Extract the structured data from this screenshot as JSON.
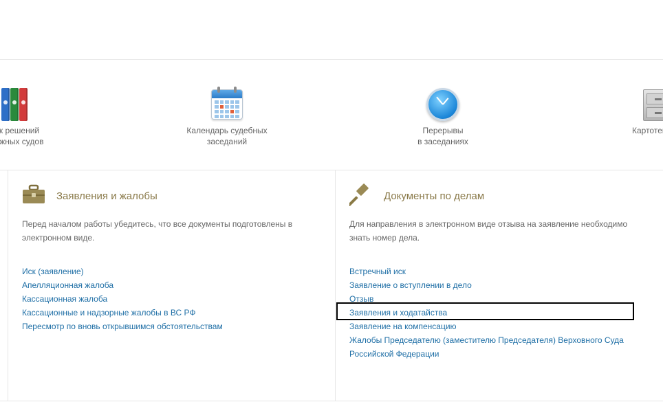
{
  "nav": {
    "items": [
      {
        "label": "к решений\nажных судов",
        "icon": "folders-icon"
      },
      {
        "label": "Календарь судебных\nзаседаний",
        "icon": "calendar-icon"
      },
      {
        "label": "Перерывы\nв заседаниях",
        "icon": "clock-icon"
      },
      {
        "label": "Картотек",
        "icon": "file-cabinet-icon"
      }
    ]
  },
  "left_panel": {
    "title": "Заявления и жалобы",
    "icon": "briefcase-icon",
    "description": "Перед началом работы убедитесь, что все документы подготовлены в электронном виде.",
    "links": [
      "Иск (заявление)",
      "Апелляционная жалоба",
      "Кассационная жалоба",
      "Кассационные и надзорные жалобы в ВС РФ",
      "Пересмотр по вновь открывшимся обстоятельствам"
    ]
  },
  "right_panel": {
    "title": "Документы по делам",
    "icon": "gavel-icon",
    "description": "Для направления в электронном виде отзыва на заявление необходимо знать номер дела.",
    "links": [
      "Встречный иск",
      "Заявление о вступлении в дело",
      "Отзыв",
      "Заявления и ходатайства",
      "Заявление на компенсацию",
      "Жалобы Председателю (заместителю Председателя) Верховного Суда",
      "Российской Федерации"
    ]
  },
  "colors": {
    "link": "#1f6fa6",
    "panel_title": "#8a7a4a",
    "highlight_border": "#000000"
  }
}
